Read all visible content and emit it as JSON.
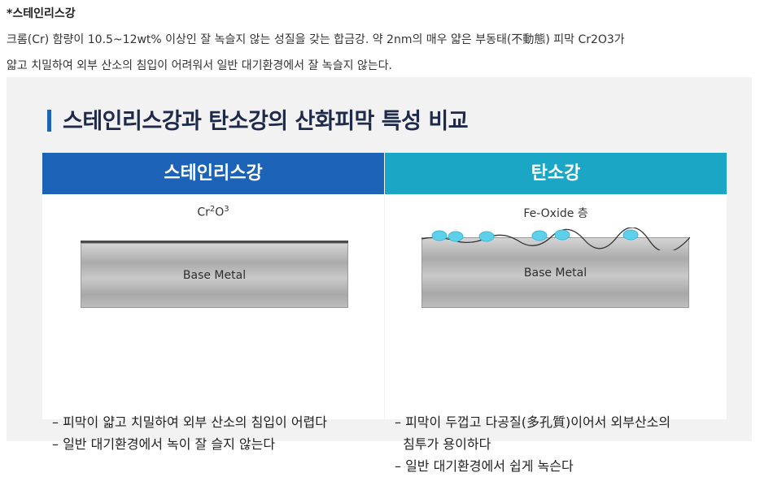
{
  "doc": {
    "heading": "*스테인리스강",
    "line1": "크롬(Cr) 함량이 10.5~12wt% 이상인 잘 녹슬지 않는 성질을 갖는 합금강. 약 2nm의 매우 얇은 부동태(不動態) 피막 Cr2O3가",
    "line2": "얇고 치밀하여 외부 산소의 침입이 어려워서 일반 대기환경에서 잘 녹슬지 않는다."
  },
  "figure": {
    "title": "스테인리스강과 탄소강의 산화피막 특성 비교",
    "left": {
      "header": "스테인리스강",
      "film_base1": "Cr",
      "film_sup1": "2",
      "film_base2": "O",
      "film_sup2": "3",
      "metal": "Base Metal",
      "bullets": [
        "– 피막이 얇고 치밀하여 외부 산소의 침입이 어렵다",
        "– 일반 대기환경에서 녹이 잘 슬지 않는다"
      ]
    },
    "right": {
      "header": "탄소강",
      "film": "Fe-Oxide 층",
      "metal": "Base Metal",
      "bullets": [
        "– 피막이 두껍고 다공질(多孔質)이어서 외부산소의",
        "  침투가 용이하다",
        "– 일반 대기환경에서 쉽게 녹슨다"
      ]
    },
    "colors": {
      "stainless_header": "#1c63b8",
      "carbon_header": "#1ca6c5",
      "oxide_bubble": "#5fd0ea"
    }
  }
}
